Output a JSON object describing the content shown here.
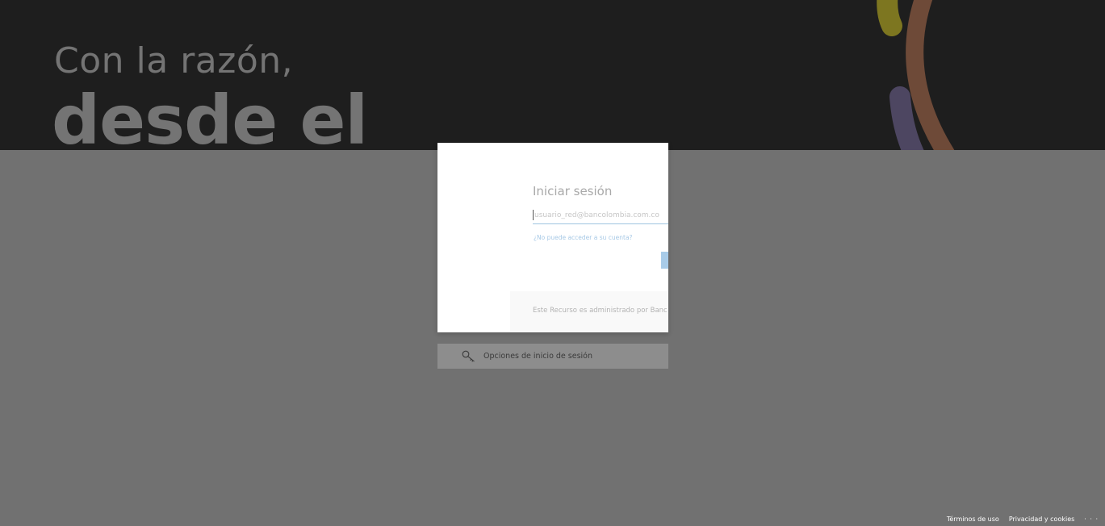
{
  "hero": {
    "line1": "Con la razón,",
    "line2": "desde el",
    "colors": {
      "background": "#1e1e1e",
      "text": "#747474",
      "deco_olive": "#7d7620",
      "deco_brown": "#6e4a38",
      "deco_purple": "#4d4661"
    }
  },
  "login": {
    "title": "Iniciar sesión",
    "email_placeholder": "usuario_red@bancolombia.com.co",
    "cant_access_link": "¿No puede acceder a su cuenta?",
    "admin_text": "Este Recurso es administrado por Banc",
    "next_button_color": "#a8cbe8"
  },
  "signin_options": {
    "icon": "key-icon",
    "label": "Opciones de inicio de sesión"
  },
  "footer": {
    "terms": "Términos de uso",
    "privacy": "Privacidad y cookies",
    "more": "· · ·"
  },
  "overlay_color": "#717171"
}
